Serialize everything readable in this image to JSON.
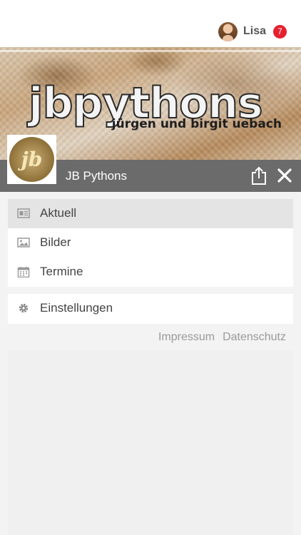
{
  "header": {
    "user": {
      "name": "Lisa",
      "notification_count": "7"
    }
  },
  "banner": {
    "brand": "jbpythons",
    "subtitle": "jürgen und birgit uebach",
    "logo_text": "jb"
  },
  "titlebar": {
    "title": "JB Pythons"
  },
  "menu": {
    "primary": [
      {
        "label": "Aktuell",
        "icon": "newspaper-icon",
        "active": true
      },
      {
        "label": "Bilder",
        "icon": "image-icon",
        "active": false
      },
      {
        "label": "Termine",
        "icon": "calendar-icon",
        "active": false
      }
    ],
    "secondary": [
      {
        "label": "Einstellungen",
        "icon": "gear-icon"
      }
    ]
  },
  "footer": {
    "links": [
      "Impressum",
      "Datenschutz"
    ]
  },
  "colors": {
    "titlebar": "#6b6b6b",
    "badge": "#e5202e",
    "active_item": "#e4e4e4"
  }
}
